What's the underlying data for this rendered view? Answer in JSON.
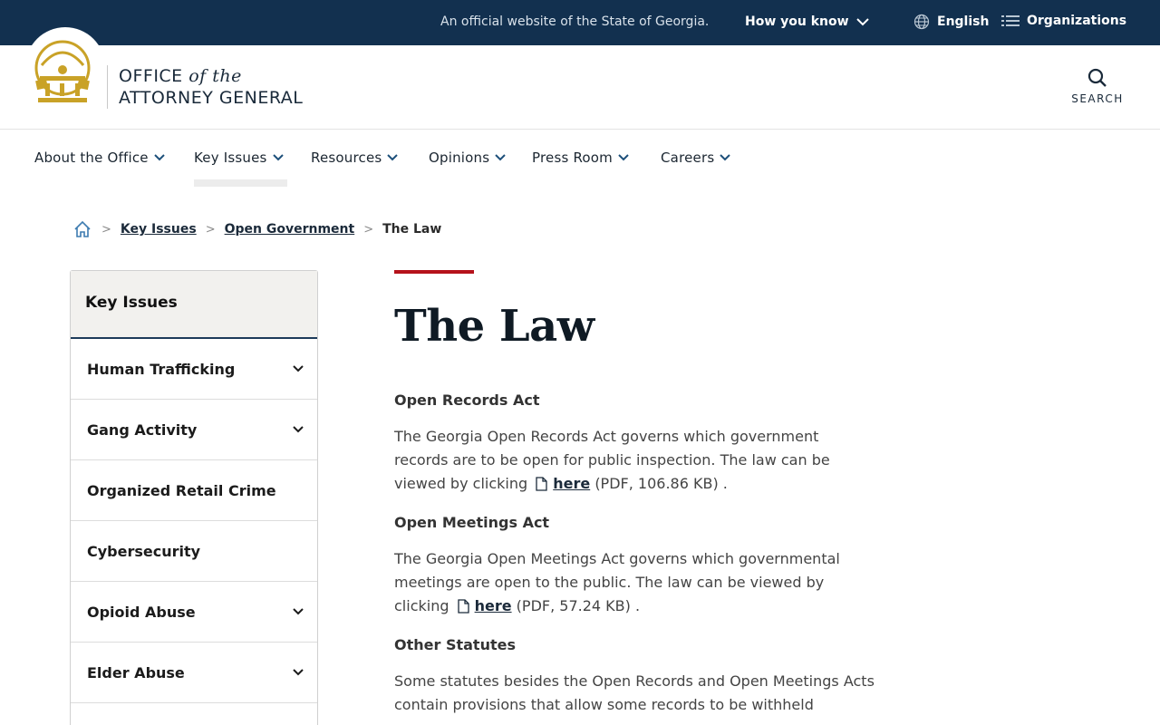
{
  "topbar": {
    "official_text": "An official website of the State of Georgia.",
    "how_you_know": "How you know",
    "language": "English",
    "organizations": "Organizations"
  },
  "header": {
    "logo_line1_a": "OFFICE",
    "logo_line1_b": "of the",
    "logo_line2": "ATTORNEY GENERAL",
    "search_label": "SEARCH"
  },
  "nav": {
    "items": [
      {
        "label": "About the Office"
      },
      {
        "label": "Key Issues"
      },
      {
        "label": "Resources"
      },
      {
        "label": "Opinions"
      },
      {
        "label": "Press Room"
      },
      {
        "label": "Careers"
      }
    ]
  },
  "breadcrumb": {
    "items": [
      "Key Issues",
      "Open Government"
    ],
    "current": "The Law"
  },
  "sidebar": {
    "heading": "Key Issues",
    "items": [
      {
        "label": "Human Trafficking",
        "expandable": true
      },
      {
        "label": "Gang Activity",
        "expandable": true
      },
      {
        "label": "Organized Retail Crime",
        "expandable": false
      },
      {
        "label": "Cybersecurity",
        "expandable": false
      },
      {
        "label": "Opioid Abuse",
        "expandable": true
      },
      {
        "label": "Elder Abuse",
        "expandable": true
      }
    ]
  },
  "content": {
    "title": "The Law",
    "sections": [
      {
        "heading": "Open Records Act",
        "text_before": "The Georgia Open Records Act governs which government records are to be open for public inspection. The law can be viewed by clicking",
        "link": "here",
        "text_after": "(PDF, 106.86 KB) ."
      },
      {
        "heading": "Open Meetings Act",
        "text_before": "The Georgia Open Meetings Act governs which governmental meetings are open to the public. The law can be viewed by clicking",
        "link": "here",
        "text_after": "(PDF, 57.24 KB) ."
      },
      {
        "heading": "Other Statutes",
        "text_before": "Some statutes besides the Open Records and Open Meetings Acts contain provisions that allow some records to be withheld",
        "link": "",
        "text_after": ""
      }
    ]
  },
  "colors": {
    "topbar_bg": "#12304f",
    "accent_red": "#b5121b",
    "seal_gold": "#c9a227"
  }
}
